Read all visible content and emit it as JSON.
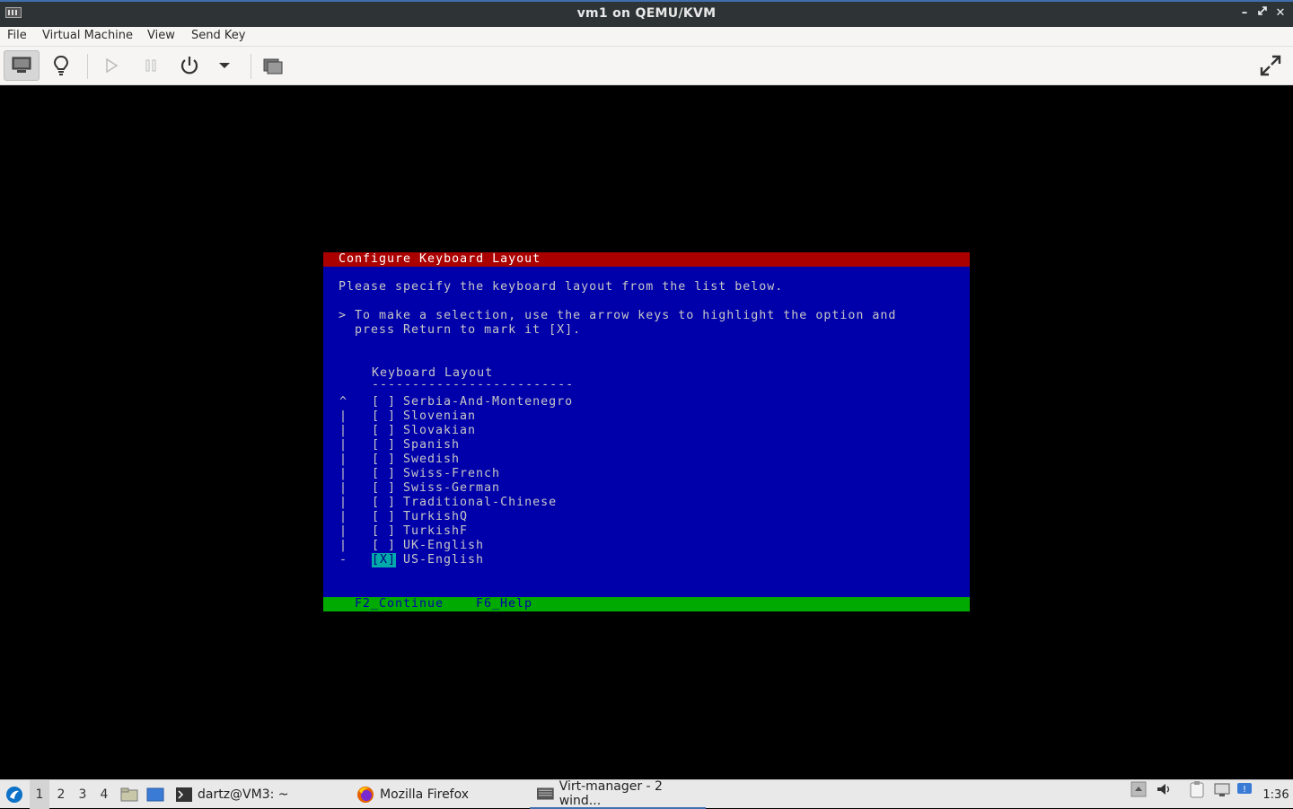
{
  "window": {
    "title": "vm1 on QEMU/KVM"
  },
  "menubar": {
    "items": [
      "File",
      "Virtual Machine",
      "View",
      "Send Key"
    ]
  },
  "toolbar": {
    "buttons": [
      "console-view",
      "details-view",
      "run",
      "pause",
      "shutdown",
      "shutdown-menu",
      "snapshots",
      "fullscreen"
    ]
  },
  "installer": {
    "header": "Configure Keyboard Layout",
    "intro": "Please specify the keyboard layout from the list below.",
    "instruction_line1": "> To make a selection, use the arrow keys to highlight the option and",
    "instruction_line2": "  press Return to mark it [X].",
    "list_heading": "Keyboard Layout",
    "list_rule": "-------------------------",
    "items": [
      {
        "scroll": "^",
        "box": "[ ]",
        "label": "Serbia-And-Montenegro"
      },
      {
        "scroll": "|",
        "box": "[ ]",
        "label": "Slovenian"
      },
      {
        "scroll": "|",
        "box": "[ ]",
        "label": "Slovakian"
      },
      {
        "scroll": "|",
        "box": "[ ]",
        "label": "Spanish"
      },
      {
        "scroll": "|",
        "box": "[ ]",
        "label": "Swedish"
      },
      {
        "scroll": "|",
        "box": "[ ]",
        "label": "Swiss-French"
      },
      {
        "scroll": "|",
        "box": "[ ]",
        "label": "Swiss-German"
      },
      {
        "scroll": "|",
        "box": "[ ]",
        "label": "Traditional-Chinese"
      },
      {
        "scroll": "|",
        "box": "[ ]",
        "label": "TurkishQ"
      },
      {
        "scroll": "|",
        "box": "[ ]",
        "label": "TurkishF"
      },
      {
        "scroll": "|",
        "box": "[ ]",
        "label": "UK-English"
      },
      {
        "scroll": "-",
        "box": "[X]",
        "label": "US-English"
      }
    ],
    "footer_continue": "F2_Continue",
    "footer_help": "F6_Help"
  },
  "taskbar": {
    "workspaces": [
      "1",
      "2",
      "3",
      "4"
    ],
    "tasks": [
      {
        "label": "dartz@VM3: ~"
      },
      {
        "label": "Mozilla Firefox"
      },
      {
        "label": "Virt-manager - 2 wind..."
      }
    ],
    "clock": "1:36"
  },
  "colors": {
    "installer_bg": "#0000aa",
    "installer_header": "#aa0000",
    "installer_footer": "#00aa00",
    "selection": "#00aaaa"
  }
}
